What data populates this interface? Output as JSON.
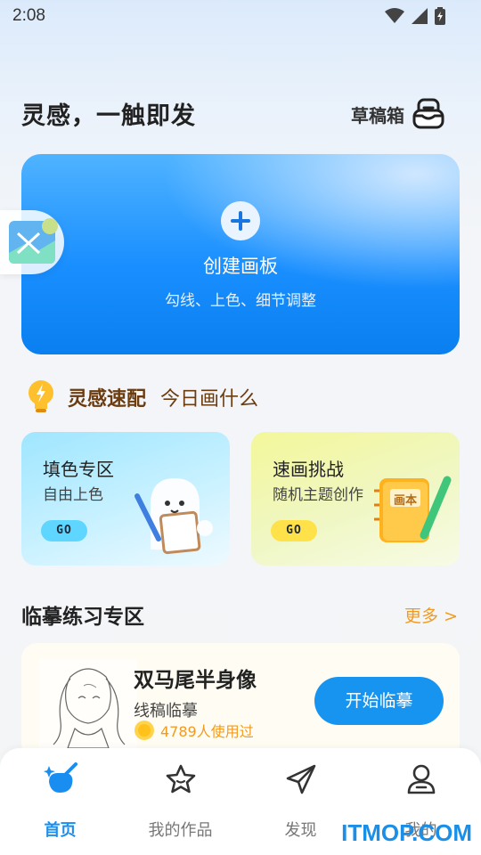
{
  "status_bar": {
    "time": "2:08"
  },
  "header": {
    "title": "灵感，一触即发",
    "drafts_label": "草稿箱"
  },
  "create_card": {
    "title": "创建画板",
    "subtitle": "勾线、上色、细节调整"
  },
  "inspiration": {
    "title": "灵感速配",
    "subtitle": "今日画什么"
  },
  "modes": [
    {
      "title": "填色专区",
      "subtitle": "自由上色",
      "badge": "GO"
    },
    {
      "title": "速画挑战",
      "subtitle": "随机主题创作",
      "badge": "GO",
      "book_label": "画本"
    }
  ],
  "practice": {
    "section_title": "临摹练习专区",
    "more_label": "更多 >",
    "card": {
      "title": "双马尾半身像",
      "subtitle": "线稿临摹",
      "users": "4789人使用过",
      "button": "开始临摹"
    }
  },
  "bottom_nav": [
    {
      "label": "首页",
      "active": true
    },
    {
      "label": "我的作品",
      "active": false
    },
    {
      "label": "发现",
      "active": false
    },
    {
      "label": "我的",
      "active": false
    }
  ],
  "watermark": "ITMOP.COM",
  "colors": {
    "accent": "#1a8ef0",
    "orange": "#f39a1e",
    "brown": "#6b3c10"
  }
}
